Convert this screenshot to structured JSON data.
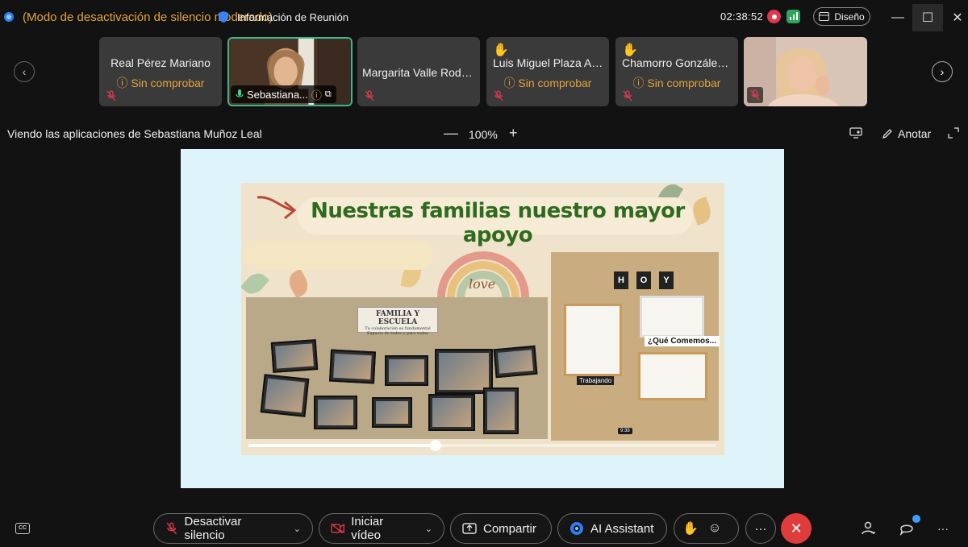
{
  "titlebar": {
    "mode_text": "(Modo de desactivación de silencio moderado)",
    "meeting_info": "Información de Reunión",
    "timer": "02:38:52",
    "layout_label": "Diseño",
    "minimize": "—",
    "maximize": "☐",
    "close": "✕"
  },
  "participants": [
    {
      "name": "Real Pérez Mariano",
      "status": "Sin comprobar",
      "hand": false
    },
    {
      "name": "Sebastiana...",
      "active": true
    },
    {
      "name": "Margarita Valle Rodrí...",
      "status": "",
      "hand": false
    },
    {
      "name": "Luis Miguel Plaza Ab...",
      "status": "Sin comprobar",
      "hand": true
    },
    {
      "name": "Chamorro González L...",
      "status": "Sin comprobar",
      "hand": true
    },
    {
      "name": "",
      "video": true
    }
  ],
  "share": {
    "title": "Viendo las aplicaciones de Sebastiana Muñoz Leal",
    "zoom": "100%",
    "zoom_minus": "—",
    "zoom_plus": "+",
    "annotate_label": "Anotar"
  },
  "slide": {
    "title": "Nuestras familias nuestro mayor apoyo",
    "love": "love",
    "sign_title": "FAMILIA Y ESCUELA",
    "sign_sub1": "Tu colaboración es fundamental",
    "sign_sub2": "Espacio de todos y para todos",
    "hoy": [
      "H",
      "O",
      "Y"
    ],
    "que_comemos": "¿Qué Comemos...",
    "trabajando": "Trabajando",
    "time_tip": "9:38",
    "progress_fraction": 0.4
  },
  "toolbar": {
    "mute_label": "Desactivar silencio",
    "video_label": "Iniciar vídeo",
    "share_label": "Compartir",
    "ai_label": "AI Assistant",
    "more_label": "···",
    "end_label": "✕",
    "cc_label": "CC"
  },
  "colors": {
    "accent_orange": "#e3a43b",
    "active_border": "#3fb58e",
    "end_red": "#e13c3c",
    "slide_title_green": "#2f6b1f"
  }
}
